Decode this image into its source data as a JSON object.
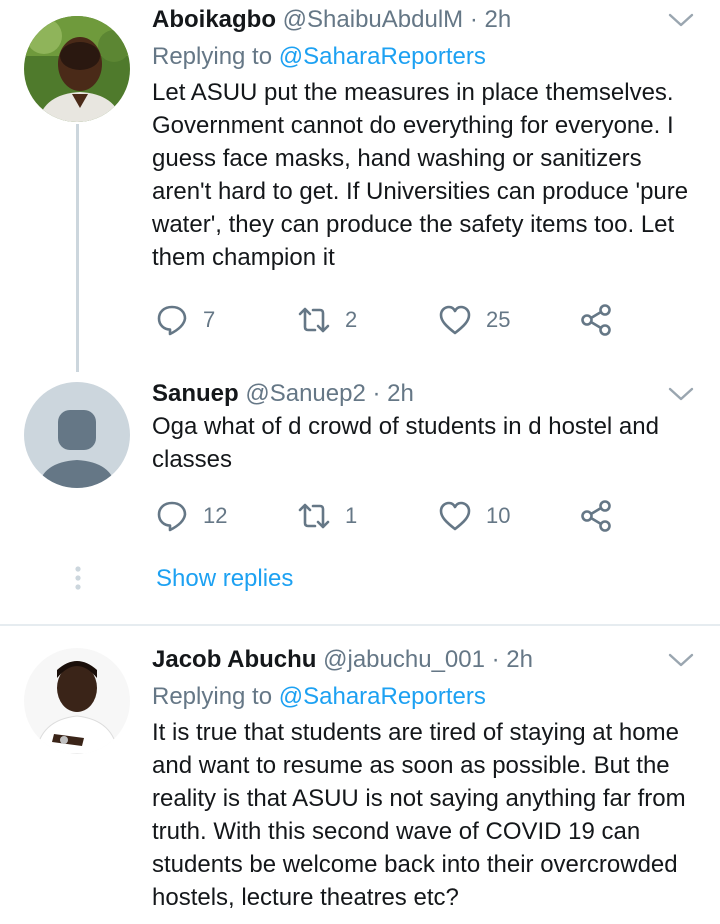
{
  "tweets": [
    {
      "name": "Aboikagbo",
      "handle": "@ShaibuAbdulM",
      "time": "· 2h",
      "replying_prefix": "Replying to",
      "replying_to": "@SaharaReporters",
      "text": "Let ASUU put the measures in place themselves. Government cannot do everything for everyone. I guess face masks, hand washing or sanitizers aren't hard to get. If Universities can produce 'pure water', they can produce the safety items too. Let them champion it",
      "replies": "7",
      "retweets": "2",
      "likes": "25"
    },
    {
      "name": "Sanuep",
      "handle": "@Sanuep2",
      "time": "· 2h",
      "text": "Oga what of d crowd of students  in d hostel and classes",
      "replies": "12",
      "retweets": "1",
      "likes": "10"
    },
    {
      "name": "Jacob Abuchu",
      "handle": "@jabuchu_001",
      "time": "· 2h",
      "replying_prefix": "Replying to",
      "replying_to": "@SaharaReporters",
      "text": "It is true that students are tired of staying at home  and want to resume as soon as possible. But the reality is that ASUU is not saying anything far from truth. With this second wave of COVID 19 can students be welcome back into their overcrowded hostels, lecture theatres etc?"
    }
  ],
  "show_replies": "Show replies",
  "colors": {
    "accent": "#1da1f2",
    "muted": "#657786",
    "line": "#ccd6dd"
  },
  "icons": [
    "reply-icon",
    "retweet-icon",
    "like-icon",
    "share-icon",
    "chevron-down-icon",
    "more-dots-icon"
  ]
}
